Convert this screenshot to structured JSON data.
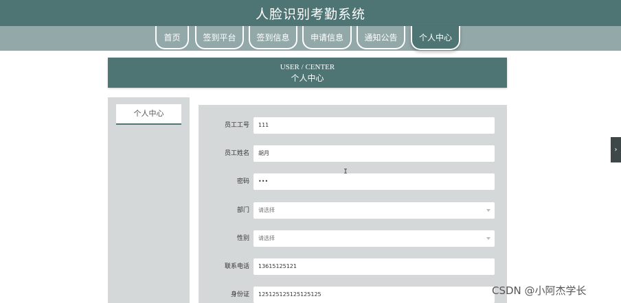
{
  "app": {
    "title": "人脸识别考勤系统"
  },
  "nav": {
    "items": [
      {
        "label": "首页"
      },
      {
        "label": "签到平台"
      },
      {
        "label": "签到信息"
      },
      {
        "label": "申请信息"
      },
      {
        "label": "通知公告"
      },
      {
        "label": "个人中心",
        "active": true
      }
    ]
  },
  "banner": {
    "en": "USER / CENTER",
    "cn": "个人中心"
  },
  "sidebar": {
    "items": [
      {
        "label": "个人中心"
      }
    ]
  },
  "form": {
    "fields": [
      {
        "label": "员工工号",
        "value": "111"
      },
      {
        "label": "员工姓名",
        "value": "胡月"
      },
      {
        "label": "密码",
        "value": "•••"
      },
      {
        "label": "部门",
        "value": "请选择"
      },
      {
        "label": "性别",
        "value": "请选择"
      },
      {
        "label": "联系电话",
        "value": "13615125121"
      },
      {
        "label": "身份证",
        "value": "125125125125125125"
      }
    ]
  },
  "cursor": {
    "glyph": "I"
  },
  "edge_tab": {
    "glyph": "›"
  },
  "watermark": {
    "text": "CSDN @小阿杰学长"
  },
  "colors": {
    "primary": "#4e7474",
    "nav_bg": "#93a9a9",
    "panel_bg": "#d4d8d8"
  }
}
